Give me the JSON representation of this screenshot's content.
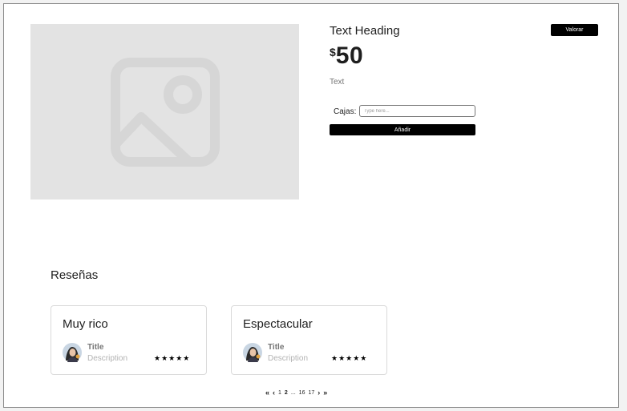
{
  "product": {
    "heading": "Text Heading",
    "price_currency": "$",
    "price_amount": "50",
    "description": "Text",
    "quantity_label": "Cajas:",
    "quantity_placeholder": "Type here...",
    "add_button": "Añadir",
    "rate_button": "Valorar",
    "image_icon": "image-placeholder-icon"
  },
  "reviews": {
    "title": "Reseñas",
    "items": [
      {
        "title": "Muy rico",
        "user_title": "Title",
        "user_description": "Description",
        "stars": "★★★★★",
        "rating": 5
      },
      {
        "title": "Espectacular",
        "user_title": "Title",
        "user_description": "Description",
        "stars": "★★★★★",
        "rating": 5
      }
    ]
  },
  "pagination": {
    "first": "«",
    "prev": "‹",
    "pages": [
      "1",
      "2",
      "...",
      "16",
      "17"
    ],
    "current": "2",
    "next": "›",
    "last": "»"
  },
  "colors": {
    "background": "#ffffff",
    "primary_button": "#000000",
    "image_placeholder": "#e3e3e3",
    "muted_text": "#757575"
  }
}
